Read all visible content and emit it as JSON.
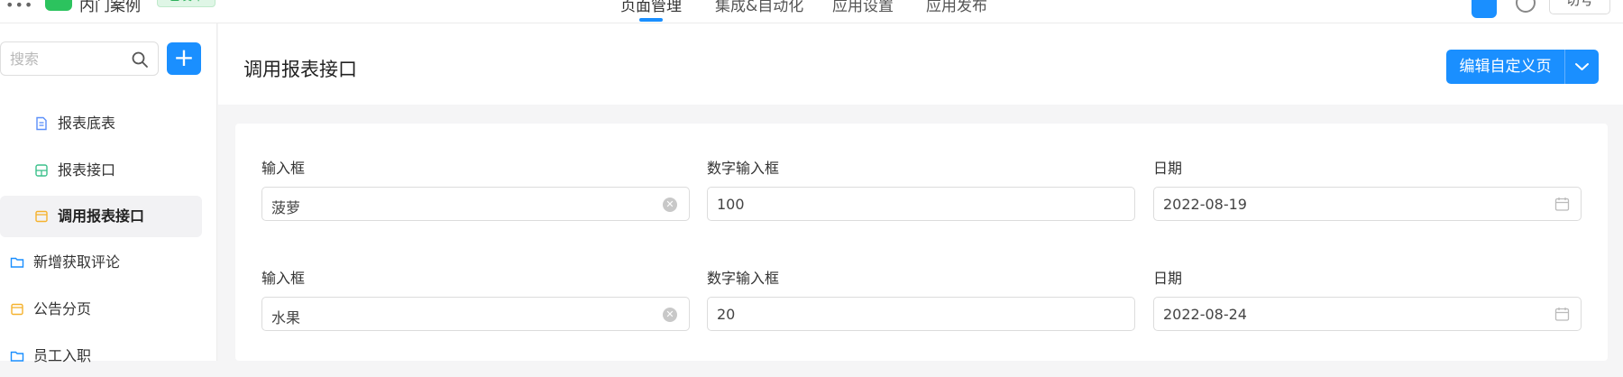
{
  "topbar": {
    "menu_glyph": "•••",
    "app_name": "内门案例",
    "app_badge": "已发布",
    "nav": [
      "页面管理",
      "集成&自动化",
      "应用设置",
      "应用发布"
    ],
    "user_button": "切号"
  },
  "sidebar": {
    "search_placeholder": "搜索",
    "add_label": "+",
    "items": [
      {
        "label": "报表底表",
        "icon": "document-icon",
        "color": "#5b8ff9"
      },
      {
        "label": "报表接口",
        "icon": "table-icon",
        "color": "#3cc08b"
      },
      {
        "label": "调用报表接口",
        "icon": "form-icon",
        "color": "#f5b22e"
      },
      {
        "label": "新增获取评论",
        "icon": "folder-icon",
        "color": "#1a8fff"
      },
      {
        "label": "公告分页",
        "icon": "form-icon",
        "color": "#f5b22e"
      },
      {
        "label": "员工入职",
        "icon": "folder-icon",
        "color": "#1a8fff"
      }
    ]
  },
  "main": {
    "title": "调用报表接口",
    "edit_button": "编辑自定义页",
    "rows": [
      {
        "text_label": "输入框",
        "text_value": "菠萝",
        "number_label": "数字输入框",
        "number_value": "100",
        "date_label": "日期",
        "date_value": "2022-08-19"
      },
      {
        "text_label": "输入框",
        "text_value": "水果",
        "number_label": "数字输入框",
        "number_value": "20",
        "date_label": "日期",
        "date_value": "2022-08-24"
      }
    ]
  },
  "colors": {
    "accent": "#1a8fff",
    "brand_green": "#2cc35e"
  }
}
